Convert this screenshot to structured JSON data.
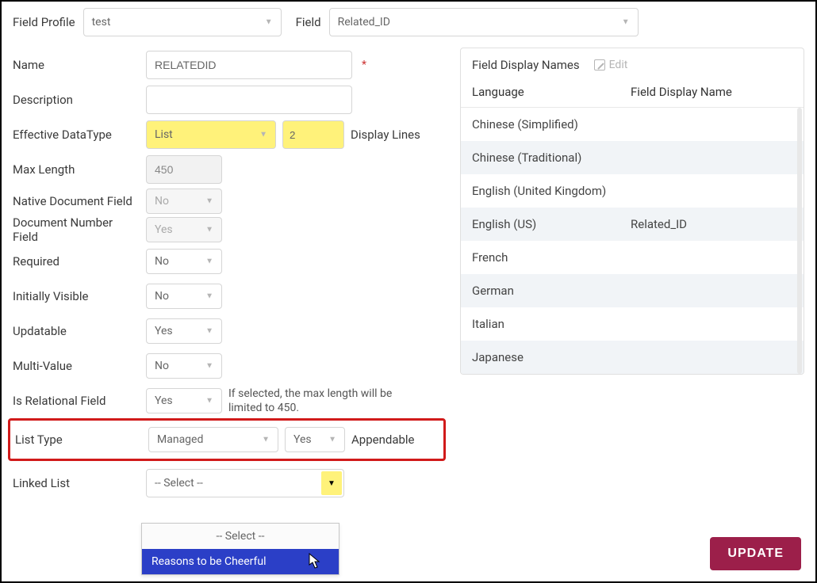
{
  "top": {
    "field_profile_label": "Field Profile",
    "field_profile_value": "test",
    "field_label": "Field",
    "field_value": "Related_ID"
  },
  "form": {
    "name_label": "Name",
    "name_value": "RELATEDID",
    "description_label": "Description",
    "description_value": "",
    "datatype_label": "Effective DataType",
    "datatype_value": "List",
    "display_lines_label": "Display Lines",
    "display_lines_value": "2",
    "maxlen_label": "Max Length",
    "maxlen_value": "450",
    "native_label": "Native Document Field",
    "native_value": "No",
    "docnum_label": "Document Number Field",
    "docnum_value": "Yes",
    "required_label": "Required",
    "required_value": "No",
    "init_visible_label": "Initially Visible",
    "init_visible_value": "No",
    "updatable_label": "Updatable",
    "updatable_value": "Yes",
    "multi_label": "Multi-Value",
    "multi_value": "No",
    "relational_label": "Is Relational Field",
    "relational_value": "Yes",
    "relational_note": "If selected, the max length will be limited to 450.",
    "list_type_label": "List Type",
    "list_type_value": "Managed",
    "appendable_value": "Yes",
    "appendable_label": "Appendable",
    "linked_label": "Linked List",
    "linked_value": "-- Select --",
    "linked_options": {
      "placeholder": "-- Select --",
      "item1": "Reasons to be Cheerful"
    }
  },
  "panel": {
    "title": "Field Display Names",
    "edit": "Edit",
    "col_lang": "Language",
    "col_name": "Field Display Name",
    "rows": [
      {
        "lang": "Chinese (Simplified)",
        "name": ""
      },
      {
        "lang": "Chinese (Traditional)",
        "name": ""
      },
      {
        "lang": "English (United Kingdom)",
        "name": ""
      },
      {
        "lang": "English (US)",
        "name": "Related_ID"
      },
      {
        "lang": "French",
        "name": ""
      },
      {
        "lang": "German",
        "name": ""
      },
      {
        "lang": "Italian",
        "name": ""
      },
      {
        "lang": "Japanese",
        "name": ""
      }
    ]
  },
  "update_button": "UPDATE"
}
